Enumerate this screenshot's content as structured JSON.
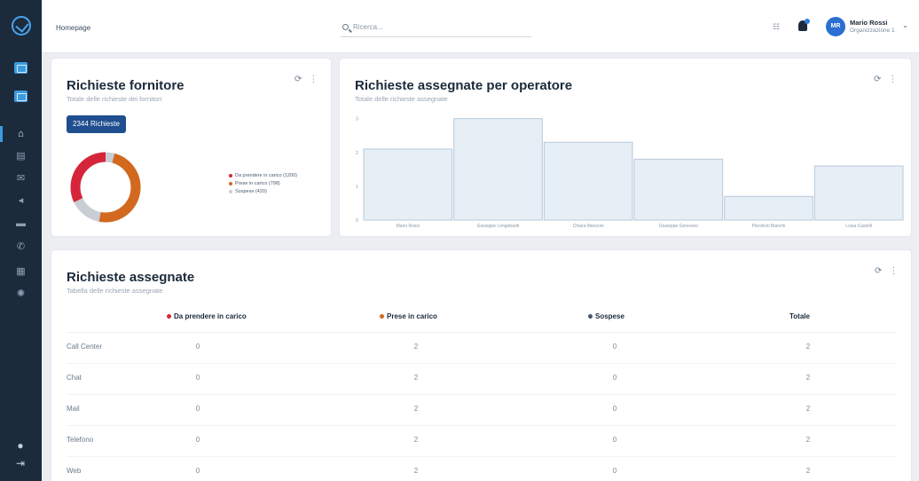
{
  "header": {
    "breadcrumb": "Homepage",
    "search_placeholder": "Ricerca...",
    "user_name": "Mario Rossi",
    "user_role": "Organizzazione 1",
    "avatar_initials": "MR"
  },
  "card_supplier": {
    "title": "Richieste fornitore",
    "subtitle": "Totale delle richieste dei fornitori",
    "badge": "2344 Richieste",
    "legend": [
      {
        "label": "Da prendere in carico (1200)",
        "color": "#d6253a"
      },
      {
        "label": "Prese in carico (798)",
        "color": "#d2691e"
      },
      {
        "label": "Sospese (420)",
        "color": "#c9ced4"
      }
    ],
    "colors": {
      "red": "#d6253a",
      "orange": "#d2691e",
      "gray": "#c9ced4"
    }
  },
  "card_operator": {
    "title": "Richieste assegnate per operatore",
    "subtitle": "Totale delle richieste assegnate",
    "chart_data": {
      "type": "bar",
      "categories": [
        "Mario Rossi",
        "Giuseppe Longobardi",
        "Chiara Manzoni",
        "Giuseppe Genovesi",
        "Piersilvio Bianchi",
        "Luisa Castelli"
      ],
      "values": [
        2.1,
        3.0,
        2.3,
        1.8,
        0.7,
        1.6
      ],
      "ylim": [
        0,
        3.2
      ],
      "yticks": [
        "0",
        "1",
        "2",
        "3"
      ],
      "bar_color": "#e6eef6",
      "bar_border": "#b9c9da"
    }
  },
  "card_table": {
    "title": "Richieste assegnate",
    "subtitle": "Tabella delle richieste assegnate",
    "columns": [
      {
        "label": "Da prendere in carico",
        "color": "#d6253a"
      },
      {
        "label": "Prese in carico",
        "color": "#d2691e"
      },
      {
        "label": "Sospese",
        "color": "#4a5866"
      },
      {
        "label": "Totale",
        "color": ""
      }
    ],
    "rows": [
      {
        "label": "Call Center",
        "values": [
          "0",
          "2",
          "0",
          "2"
        ]
      },
      {
        "label": "Chat",
        "values": [
          "0",
          "2",
          "0",
          "2"
        ]
      },
      {
        "label": "Mail",
        "values": [
          "0",
          "2",
          "0",
          "2"
        ]
      },
      {
        "label": "Telefono",
        "values": [
          "0",
          "2",
          "0",
          "2"
        ]
      },
      {
        "label": "Web",
        "values": [
          "0",
          "2",
          "0",
          "2"
        ]
      }
    ]
  },
  "tools": {
    "refresh": "⟳",
    "more": "⋮"
  }
}
